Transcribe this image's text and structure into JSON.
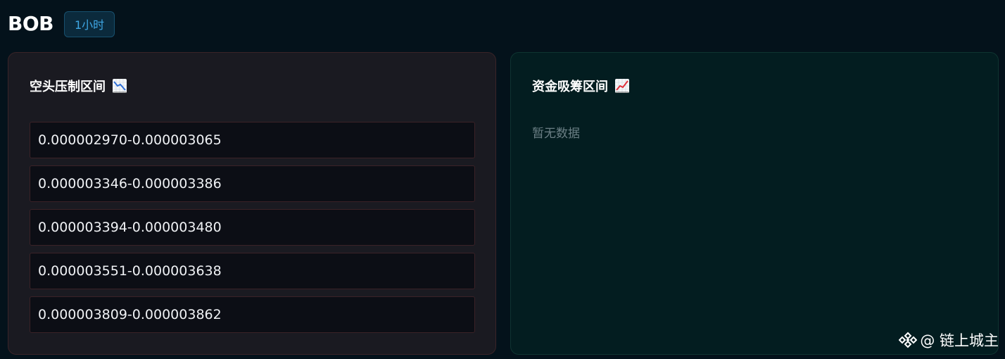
{
  "header": {
    "symbol": "BOB",
    "timeframe": "1小时"
  },
  "bear_panel": {
    "title": "空头压制区间",
    "icon": "chart-decreasing-icon",
    "zones": [
      "0.000002970-0.000003065",
      "0.000003346-0.000003386",
      "0.000003394-0.000003480",
      "0.000003551-0.000003638",
      "0.000003809-0.000003862"
    ]
  },
  "bull_panel": {
    "title": "资金吸筹区间",
    "icon": "chart-increasing-icon",
    "empty_text": "暂无数据"
  },
  "watermark": {
    "text": "@ 链上城主",
    "icon": "binance-logo-icon"
  }
}
